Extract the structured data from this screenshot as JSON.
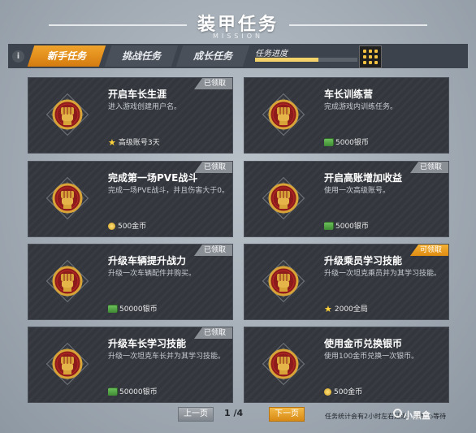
{
  "header": {
    "title": "装甲任务",
    "subtitle": "MISSION"
  },
  "tabs": [
    {
      "label": "新手任务",
      "active": true
    },
    {
      "label": "挑战任务",
      "active": false
    },
    {
      "label": "成长任务",
      "active": false
    }
  ],
  "progress": {
    "label": "任务进度",
    "value": 0.62
  },
  "cards": [
    {
      "title": "开启车长生涯",
      "desc": "进入游戏创建用户名。",
      "badge": "已领取",
      "badge_type": "claimed",
      "reward_icon": "star",
      "reward": "高级账号3天"
    },
    {
      "title": "车长训练营",
      "desc": "完成游戏内训练任务。",
      "badge": "",
      "badge_type": "",
      "reward_icon": "notes",
      "reward": "5000银币"
    },
    {
      "title": "完成第一场PVE战斗",
      "desc": "完成一场PVE战斗，并且伤害大于0。",
      "badge": "已领取",
      "badge_type": "claimed",
      "reward_icon": "coins",
      "reward": "500金币"
    },
    {
      "title": "开启高账增加收益",
      "desc": "使用一次高级账号。",
      "badge": "已领取",
      "badge_type": "claimed",
      "reward_icon": "notes",
      "reward": "5000银币"
    },
    {
      "title": "升级车辆提升战力",
      "desc": "升级一次车辆配件并购买。",
      "badge": "已领取",
      "badge_type": "claimed",
      "reward_icon": "notes",
      "reward": "50000银币"
    },
    {
      "title": "升级乘员学习技能",
      "desc": "升级一次坦克乘员并为其学习技能。",
      "badge": "可领取",
      "badge_type": "claimable",
      "reward_icon": "star",
      "reward": "2000全局"
    },
    {
      "title": "升级车长学习技能",
      "desc": "升级一次坦克车长并为其学习技能。",
      "badge": "已领取",
      "badge_type": "claimed",
      "reward_icon": "notes",
      "reward": "50000银币"
    },
    {
      "title": "使用金币兑换银币",
      "desc": "使用100金币兑换一次银币。",
      "badge": "",
      "badge_type": "",
      "reward_icon": "coins",
      "reward": "500金币"
    }
  ],
  "pager": {
    "prev": "上一页",
    "current": "1 /4",
    "next": "下一页"
  },
  "footer_note": "任务统计会有2小时左右延迟，请耐心等待",
  "watermark": "小黑盒",
  "colors": {
    "accent": "#e8961e",
    "card_bg": "#33373d",
    "emblem_red": "#8d1b1b",
    "emblem_gold": "#d8a437"
  }
}
